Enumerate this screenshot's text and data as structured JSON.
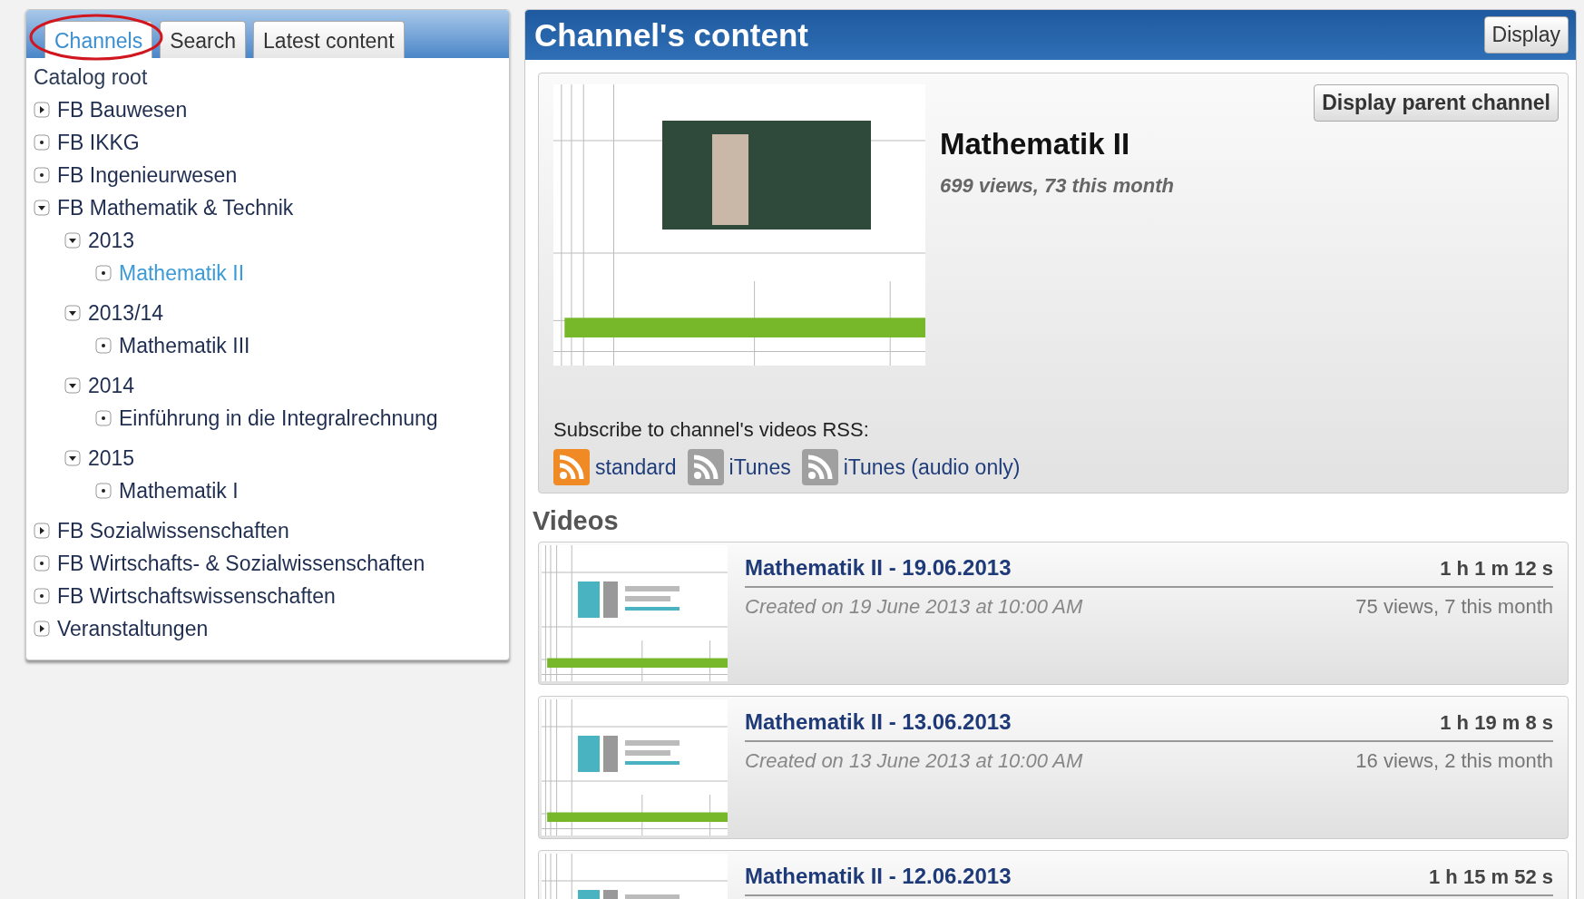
{
  "sidebar": {
    "tabs": [
      {
        "label": "Channels",
        "selected": true
      },
      {
        "label": "Search",
        "selected": false
      },
      {
        "label": "Latest content",
        "selected": false
      }
    ],
    "tree": {
      "root": "Catalog root",
      "items": [
        {
          "label": "FB Bauwesen",
          "kind": "folder",
          "expanded": false,
          "selected": false
        },
        {
          "label": "FB IKKG",
          "kind": "leaf",
          "selected": false
        },
        {
          "label": "FB Ingenieurwesen",
          "kind": "leaf",
          "selected": false
        },
        {
          "label": "FB Mathematik & Technik",
          "kind": "folder",
          "expanded": true,
          "selected": false,
          "children": [
            {
              "label": "2013",
              "kind": "folder",
              "expanded": true,
              "selected": false,
              "children": [
                {
                  "label": "Mathematik II",
                  "kind": "leaf",
                  "selected": true
                }
              ]
            },
            {
              "label": "2013/14",
              "kind": "folder",
              "expanded": true,
              "selected": false,
              "children": [
                {
                  "label": "Mathematik III",
                  "kind": "leaf",
                  "selected": false
                }
              ]
            },
            {
              "label": "2014",
              "kind": "folder",
              "expanded": true,
              "selected": false,
              "children": [
                {
                  "label": "Einführung in die Integralrechnung",
                  "kind": "leaf",
                  "selected": false
                }
              ]
            },
            {
              "label": "2015",
              "kind": "folder",
              "expanded": true,
              "selected": false,
              "children": [
                {
                  "label": "Mathematik I",
                  "kind": "leaf",
                  "selected": false
                }
              ]
            }
          ]
        },
        {
          "label": "FB Sozialwissenschaften",
          "kind": "folder",
          "expanded": false,
          "selected": false
        },
        {
          "label": "FB Wirtschafts- & Sozialwissenschaften",
          "kind": "leaf",
          "selected": false
        },
        {
          "label": "FB Wirtschaftswissenschaften",
          "kind": "leaf",
          "selected": false
        },
        {
          "label": "Veranstaltungen",
          "kind": "folder",
          "expanded": false,
          "selected": false
        }
      ]
    }
  },
  "content": {
    "title": "Channel's content",
    "display_button": "Display",
    "channel": {
      "parent_button": "Display parent channel",
      "name": "Mathematik II",
      "stats": "699 views, 73 this month",
      "subscribe_label": "Subscribe to channel's videos RSS:",
      "feeds": [
        {
          "label": "standard",
          "color": "#f08a24"
        },
        {
          "label": "iTunes",
          "color": "#a0a0a0"
        },
        {
          "label": "iTunes (audio only)",
          "color": "#a0a0a0"
        }
      ]
    },
    "videos_heading": "Videos",
    "videos": [
      {
        "title": "Mathematik II - 19.06.2013",
        "duration": "1 h 1 m 12 s",
        "created": "Created on 19 June 2013 at 10:00 AM",
        "views": "75 views, 7 this month"
      },
      {
        "title": "Mathematik II - 13.06.2013",
        "duration": "1 h 19 m 8 s",
        "created": "Created on 13 June 2013 at 10:00 AM",
        "views": "16 views, 2 this month"
      },
      {
        "title": "Mathematik II - 12.06.2013",
        "duration": "1 h 15 m 52 s"
      }
    ]
  }
}
